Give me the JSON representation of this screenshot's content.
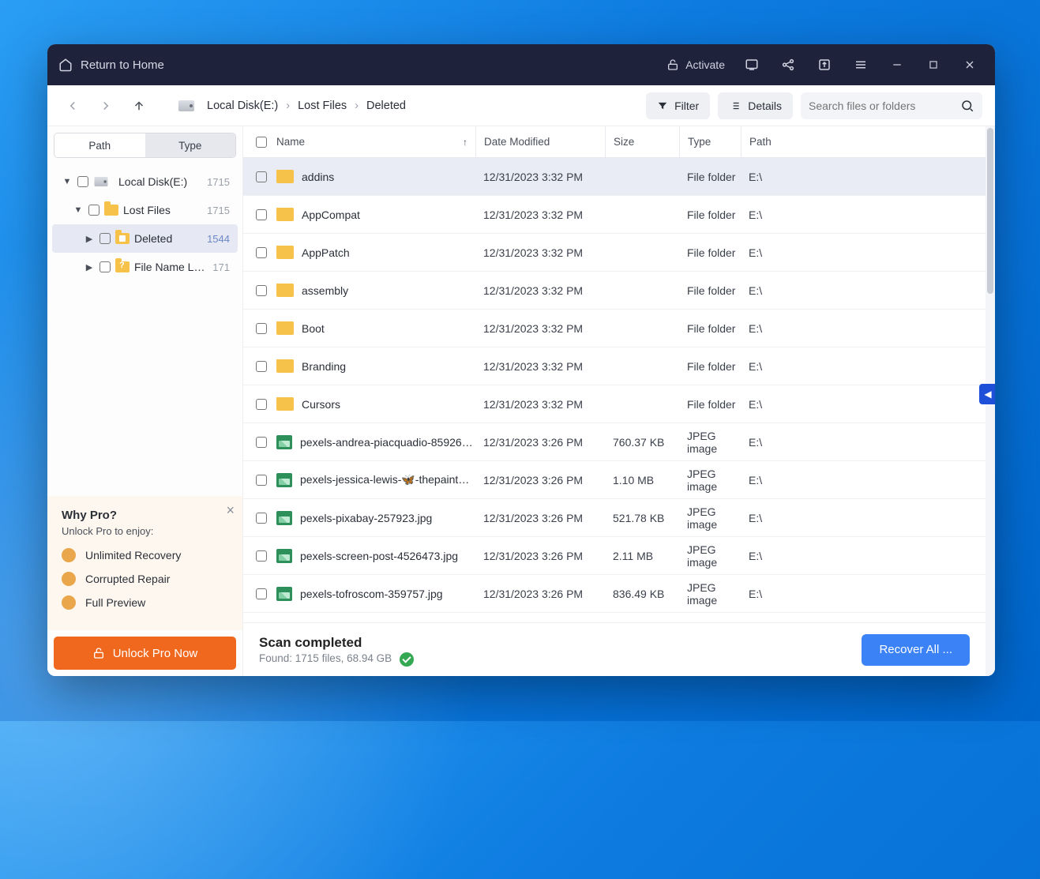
{
  "titlebar": {
    "home_label": "Return to Home",
    "activate_label": "Activate"
  },
  "toolbar": {
    "filter_label": "Filter",
    "details_label": "Details",
    "search_placeholder": "Search files or folders"
  },
  "breadcrumb": {
    "c0": "Local Disk(E:)",
    "c1": "Lost Files",
    "c2": "Deleted"
  },
  "sidebar": {
    "tabs": {
      "path": "Path",
      "type": "Type"
    },
    "tree": {
      "root": {
        "label": "Local Disk(E:)",
        "count": "1715"
      },
      "lost": {
        "label": "Lost Files",
        "count": "1715"
      },
      "deleted": {
        "label": "Deleted",
        "count": "1544"
      },
      "namelost": {
        "label": "File Name Lost",
        "count": "171"
      }
    },
    "promo": {
      "title": "Why Pro?",
      "subtitle": "Unlock Pro to enjoy:",
      "f1": "Unlimited Recovery",
      "f2": "Corrupted Repair",
      "f3": "Full Preview",
      "cta": "Unlock Pro Now"
    }
  },
  "columns": {
    "name": "Name",
    "date": "Date Modified",
    "size": "Size",
    "type": "Type",
    "path": "Path"
  },
  "rows": [
    {
      "name": "addins",
      "date": "12/31/2023 3:32 PM",
      "size": "",
      "type": "File folder",
      "path": "E:\\",
      "icon": "folder",
      "selected": true
    },
    {
      "name": "AppCompat",
      "date": "12/31/2023 3:32 PM",
      "size": "",
      "type": "File folder",
      "path": "E:\\",
      "icon": "folder"
    },
    {
      "name": "AppPatch",
      "date": "12/31/2023 3:32 PM",
      "size": "",
      "type": "File folder",
      "path": "E:\\",
      "icon": "folder"
    },
    {
      "name": "assembly",
      "date": "12/31/2023 3:32 PM",
      "size": "",
      "type": "File folder",
      "path": "E:\\",
      "icon": "folder"
    },
    {
      "name": "Boot",
      "date": "12/31/2023 3:32 PM",
      "size": "",
      "type": "File folder",
      "path": "E:\\",
      "icon": "folder"
    },
    {
      "name": "Branding",
      "date": "12/31/2023 3:32 PM",
      "size": "",
      "type": "File folder",
      "path": "E:\\",
      "icon": "folder"
    },
    {
      "name": "Cursors",
      "date": "12/31/2023 3:32 PM",
      "size": "",
      "type": "File folder",
      "path": "E:\\",
      "icon": "folder"
    },
    {
      "name": "pexels-andrea-piacquadio-85926…",
      "date": "12/31/2023 3:26 PM",
      "size": "760.37 KB",
      "type": "JPEG image",
      "path": "E:\\",
      "icon": "jpeg"
    },
    {
      "name": "pexels-jessica-lewis-🦋-thepainted…",
      "date": "12/31/2023 3:26 PM",
      "size": "1.10 MB",
      "type": "JPEG image",
      "path": "E:\\",
      "icon": "jpeg"
    },
    {
      "name": "pexels-pixabay-257923.jpg",
      "date": "12/31/2023 3:26 PM",
      "size": "521.78 KB",
      "type": "JPEG image",
      "path": "E:\\",
      "icon": "jpeg"
    },
    {
      "name": "pexels-screen-post-4526473.jpg",
      "date": "12/31/2023 3:26 PM",
      "size": "2.11 MB",
      "type": "JPEG image",
      "path": "E:\\",
      "icon": "jpeg"
    },
    {
      "name": "pexels-tofroscom-359757.jpg",
      "date": "12/31/2023 3:26 PM",
      "size": "836.49 KB",
      "type": "JPEG image",
      "path": "E:\\",
      "icon": "jpeg"
    }
  ],
  "status": {
    "title": "Scan completed",
    "subtitle": "Found: 1715 files, 68.94 GB",
    "recover": "Recover All ..."
  }
}
